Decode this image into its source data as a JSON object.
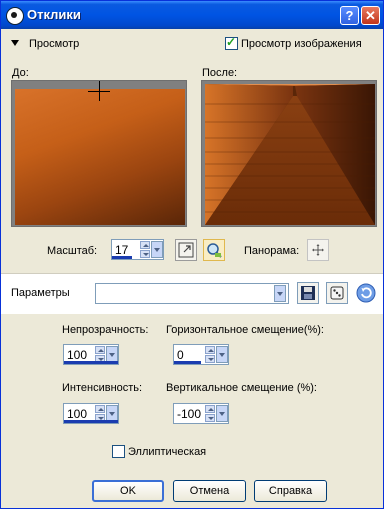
{
  "window": {
    "title": "Отклики",
    "help_button": "?",
    "close_button": "✕"
  },
  "preview": {
    "section_label": "Просмотр",
    "show_image_label": "Просмотр изображения",
    "show_image_checked": true,
    "before_label": "До:",
    "after_label": "После:",
    "zoom_label": "Масштаб:",
    "zoom_value": "17",
    "pan_label": "Панорама:"
  },
  "params": {
    "label": "Параметры",
    "combo_value": ""
  },
  "settings": {
    "opacity_label": "Непрозрачность:",
    "opacity_value": "100",
    "h_offset_label": "Горизонтальное смещение(%):",
    "h_offset_value": "0",
    "intensity_label": "Интенсивность:",
    "intensity_value": "100",
    "v_offset_label": "Вертикальное смещение (%):",
    "v_offset_value": "-100",
    "elliptical_label": "Эллиптическая",
    "elliptical_checked": false
  },
  "buttons": {
    "ok": "OK",
    "cancel": "Отмена",
    "help": "Справка"
  },
  "icons": {
    "app": "app-icon",
    "collapse": "collapse-arrow-icon",
    "fit": "fit-window-icon",
    "zoom": "zoom-magnifier-icon",
    "pan": "pan-cross-icon",
    "save": "save-disk-icon",
    "random": "random-dice-icon",
    "reset": "reset-icon"
  }
}
